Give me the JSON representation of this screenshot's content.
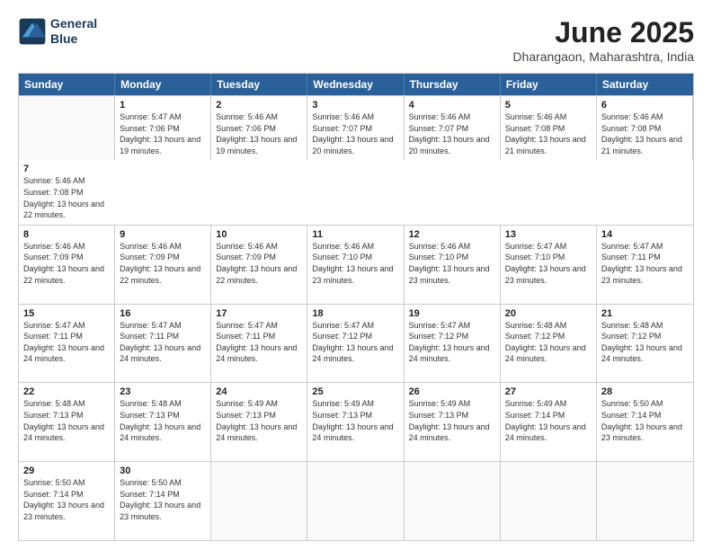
{
  "logo": {
    "line1": "General",
    "line2": "Blue"
  },
  "title": "June 2025",
  "subtitle": "Dharangaon, Maharashtra, India",
  "headers": [
    "Sunday",
    "Monday",
    "Tuesday",
    "Wednesday",
    "Thursday",
    "Friday",
    "Saturday"
  ],
  "rows": [
    [
      {
        "day": "",
        "empty": true
      },
      {
        "day": "1",
        "sunrise": "5:47 AM",
        "sunset": "7:06 PM",
        "daylight": "13 hours and 19 minutes."
      },
      {
        "day": "2",
        "sunrise": "5:46 AM",
        "sunset": "7:06 PM",
        "daylight": "13 hours and 19 minutes."
      },
      {
        "day": "3",
        "sunrise": "5:46 AM",
        "sunset": "7:07 PM",
        "daylight": "13 hours and 20 minutes."
      },
      {
        "day": "4",
        "sunrise": "5:46 AM",
        "sunset": "7:07 PM",
        "daylight": "13 hours and 20 minutes."
      },
      {
        "day": "5",
        "sunrise": "5:46 AM",
        "sunset": "7:08 PM",
        "daylight": "13 hours and 21 minutes."
      },
      {
        "day": "6",
        "sunrise": "5:46 AM",
        "sunset": "7:08 PM",
        "daylight": "13 hours and 21 minutes."
      },
      {
        "day": "7",
        "sunrise": "5:46 AM",
        "sunset": "7:08 PM",
        "daylight": "13 hours and 22 minutes."
      }
    ],
    [
      {
        "day": "8",
        "sunrise": "5:46 AM",
        "sunset": "7:09 PM",
        "daylight": "13 hours and 22 minutes."
      },
      {
        "day": "9",
        "sunrise": "5:46 AM",
        "sunset": "7:09 PM",
        "daylight": "13 hours and 22 minutes."
      },
      {
        "day": "10",
        "sunrise": "5:46 AM",
        "sunset": "7:09 PM",
        "daylight": "13 hours and 22 minutes."
      },
      {
        "day": "11",
        "sunrise": "5:46 AM",
        "sunset": "7:10 PM",
        "daylight": "13 hours and 23 minutes."
      },
      {
        "day": "12",
        "sunrise": "5:46 AM",
        "sunset": "7:10 PM",
        "daylight": "13 hours and 23 minutes."
      },
      {
        "day": "13",
        "sunrise": "5:47 AM",
        "sunset": "7:10 PM",
        "daylight": "13 hours and 23 minutes."
      },
      {
        "day": "14",
        "sunrise": "5:47 AM",
        "sunset": "7:11 PM",
        "daylight": "13 hours and 23 minutes."
      }
    ],
    [
      {
        "day": "15",
        "sunrise": "5:47 AM",
        "sunset": "7:11 PM",
        "daylight": "13 hours and 24 minutes."
      },
      {
        "day": "16",
        "sunrise": "5:47 AM",
        "sunset": "7:11 PM",
        "daylight": "13 hours and 24 minutes."
      },
      {
        "day": "17",
        "sunrise": "5:47 AM",
        "sunset": "7:11 PM",
        "daylight": "13 hours and 24 minutes."
      },
      {
        "day": "18",
        "sunrise": "5:47 AM",
        "sunset": "7:12 PM",
        "daylight": "13 hours and 24 minutes."
      },
      {
        "day": "19",
        "sunrise": "5:47 AM",
        "sunset": "7:12 PM",
        "daylight": "13 hours and 24 minutes."
      },
      {
        "day": "20",
        "sunrise": "5:48 AM",
        "sunset": "7:12 PM",
        "daylight": "13 hours and 24 minutes."
      },
      {
        "day": "21",
        "sunrise": "5:48 AM",
        "sunset": "7:12 PM",
        "daylight": "13 hours and 24 minutes."
      }
    ],
    [
      {
        "day": "22",
        "sunrise": "5:48 AM",
        "sunset": "7:13 PM",
        "daylight": "13 hours and 24 minutes."
      },
      {
        "day": "23",
        "sunrise": "5:48 AM",
        "sunset": "7:13 PM",
        "daylight": "13 hours and 24 minutes."
      },
      {
        "day": "24",
        "sunrise": "5:49 AM",
        "sunset": "7:13 PM",
        "daylight": "13 hours and 24 minutes."
      },
      {
        "day": "25",
        "sunrise": "5:49 AM",
        "sunset": "7:13 PM",
        "daylight": "13 hours and 24 minutes."
      },
      {
        "day": "26",
        "sunrise": "5:49 AM",
        "sunset": "7:13 PM",
        "daylight": "13 hours and 24 minutes."
      },
      {
        "day": "27",
        "sunrise": "5:49 AM",
        "sunset": "7:14 PM",
        "daylight": "13 hours and 24 minutes."
      },
      {
        "day": "28",
        "sunrise": "5:50 AM",
        "sunset": "7:14 PM",
        "daylight": "13 hours and 23 minutes."
      }
    ],
    [
      {
        "day": "29",
        "sunrise": "5:50 AM",
        "sunset": "7:14 PM",
        "daylight": "13 hours and 23 minutes."
      },
      {
        "day": "30",
        "sunrise": "5:50 AM",
        "sunset": "7:14 PM",
        "daylight": "13 hours and 23 minutes."
      },
      {
        "day": "",
        "empty": true
      },
      {
        "day": "",
        "empty": true
      },
      {
        "day": "",
        "empty": true
      },
      {
        "day": "",
        "empty": true
      },
      {
        "day": "",
        "empty": true
      }
    ]
  ],
  "labels": {
    "sunrise_prefix": "Sunrise: ",
    "sunset_prefix": "Sunset: ",
    "daylight_prefix": "Daylight: "
  }
}
